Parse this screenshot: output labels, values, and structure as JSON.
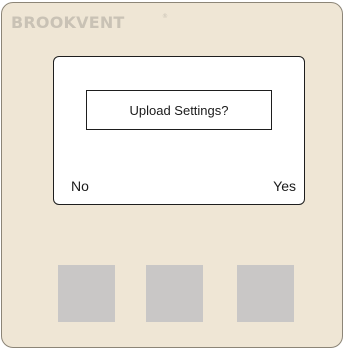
{
  "device": {
    "brand": "BROOKVENT",
    "brand_mark": "®"
  },
  "screen": {
    "prompt": "Upload Settings?",
    "softkey_left": "No",
    "softkey_right": "Yes"
  },
  "colors": {
    "panel": "#efe6d5",
    "button": "#c9c7c6",
    "screen": "#ffffff"
  }
}
